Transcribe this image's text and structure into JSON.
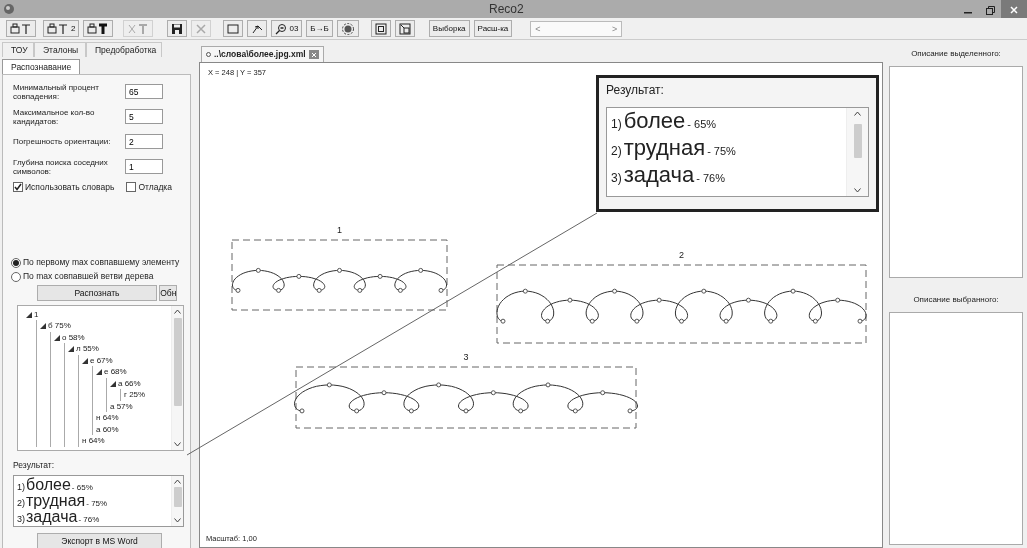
{
  "window": {
    "title": "Reco2"
  },
  "toolbar": [
    {
      "kind": "icon",
      "disabled": false
    },
    {
      "kind": "icon",
      "disabled": false,
      "label": "2"
    },
    {
      "kind": "icon",
      "disabled": false
    },
    {
      "kind": "icon",
      "disabled": true
    },
    {
      "kind": "icon",
      "disabled": false
    },
    {
      "kind": "icon",
      "disabled": true
    },
    {
      "kind": "icon",
      "disabled": false
    },
    {
      "kind": "icon",
      "disabled": false
    },
    {
      "kind": "icon",
      "disabled": false,
      "label": "03"
    },
    {
      "kind": "text",
      "label": "Б→Б",
      "disabled": false
    },
    {
      "kind": "icon",
      "disabled": false
    },
    {
      "kind": "icon",
      "disabled": false
    },
    {
      "kind": "icon",
      "disabled": false
    },
    {
      "kind": "text",
      "label": "Выборка",
      "disabled": false
    },
    {
      "kind": "text",
      "label": "Расш-ка",
      "disabled": false
    },
    {
      "kind": "scroller",
      "left": "<",
      "right": ">"
    }
  ],
  "left_panel": {
    "tabs": [
      {
        "label": "ТОУ",
        "selected": false
      },
      {
        "label": "Эталоны",
        "selected": false
      },
      {
        "label": "Предобработка",
        "selected": false
      },
      {
        "label": "Распознавание",
        "selected": true
      }
    ],
    "fields": [
      {
        "label": "Минимальный процент совпадения:",
        "value": "65"
      },
      {
        "label": "Максимальное кол-во кандидатов:",
        "value": "5"
      },
      {
        "label": "Погрешность ориентации:",
        "value": "2"
      },
      {
        "label": "Глубина поиска соседних символов:",
        "value": "1"
      }
    ],
    "checkboxes": [
      {
        "label": "Использовать словарь",
        "checked": true
      },
      {
        "label": "Отладка",
        "checked": false
      }
    ],
    "radios": [
      {
        "label": "По первому max совпавшему элементу",
        "selected": true
      },
      {
        "label": "По max совпавшей ветви дерева",
        "selected": false
      }
    ],
    "buttons": [
      "Распознать",
      "Обн"
    ],
    "tree": [
      {
        "label": "1",
        "expanded": true,
        "children": [
          {
            "label": "б 75%",
            "expanded": true,
            "children": [
              {
                "label": "о 58%",
                "expanded": true,
                "children": [
                  {
                    "label": "л 55%",
                    "expanded": true,
                    "children": [
                      {
                        "label": "е 67%",
                        "expanded": true,
                        "children": [
                          {
                            "label": "е 68%",
                            "expanded": true,
                            "children": [
                              {
                                "label": "а 66%",
                                "expanded": true,
                                "children": [
                                  {
                                    "label": "г 25%"
                                  }
                                ]
                              },
                              {
                                "label": "а 57%"
                              }
                            ]
                          },
                          {
                            "label": "н 64%"
                          },
                          {
                            "label": "а 60%"
                          }
                        ]
                      },
                      {
                        "label": "н 64%"
                      }
                    ]
                  }
                ]
              }
            ]
          }
        ]
      }
    ],
    "result_label": "Результат:",
    "results": [
      {
        "number": "1)",
        "word": "более",
        "score": "- 65%"
      },
      {
        "number": "2)",
        "word": "трудная",
        "score": "- 75%"
      },
      {
        "number": "3)",
        "word": "задача",
        "score": "- 76%"
      }
    ],
    "export_button": "Экспорт в MS Word"
  },
  "document": {
    "tab": {
      "label": "..\\слова\\более.jpg.xml",
      "selected": true
    },
    "coords": "X = 248 | Y = 357",
    "words": [
      {
        "number": "1"
      },
      {
        "number": "2"
      },
      {
        "number": "3"
      }
    ],
    "overlay": {
      "label": "Результат:",
      "results": [
        {
          "number": "1)",
          "word": "более",
          "score": "- 65%"
        },
        {
          "number": "2)",
          "word": "трудная",
          "score": "- 75%"
        },
        {
          "number": "3)",
          "word": "задача",
          "score": "- 76%"
        }
      ]
    },
    "scale": "Масштаб: 1,00"
  },
  "right_panel": {
    "selected_label": "Описание выделенного:",
    "chosen_label": "Описание выбранного:"
  }
}
